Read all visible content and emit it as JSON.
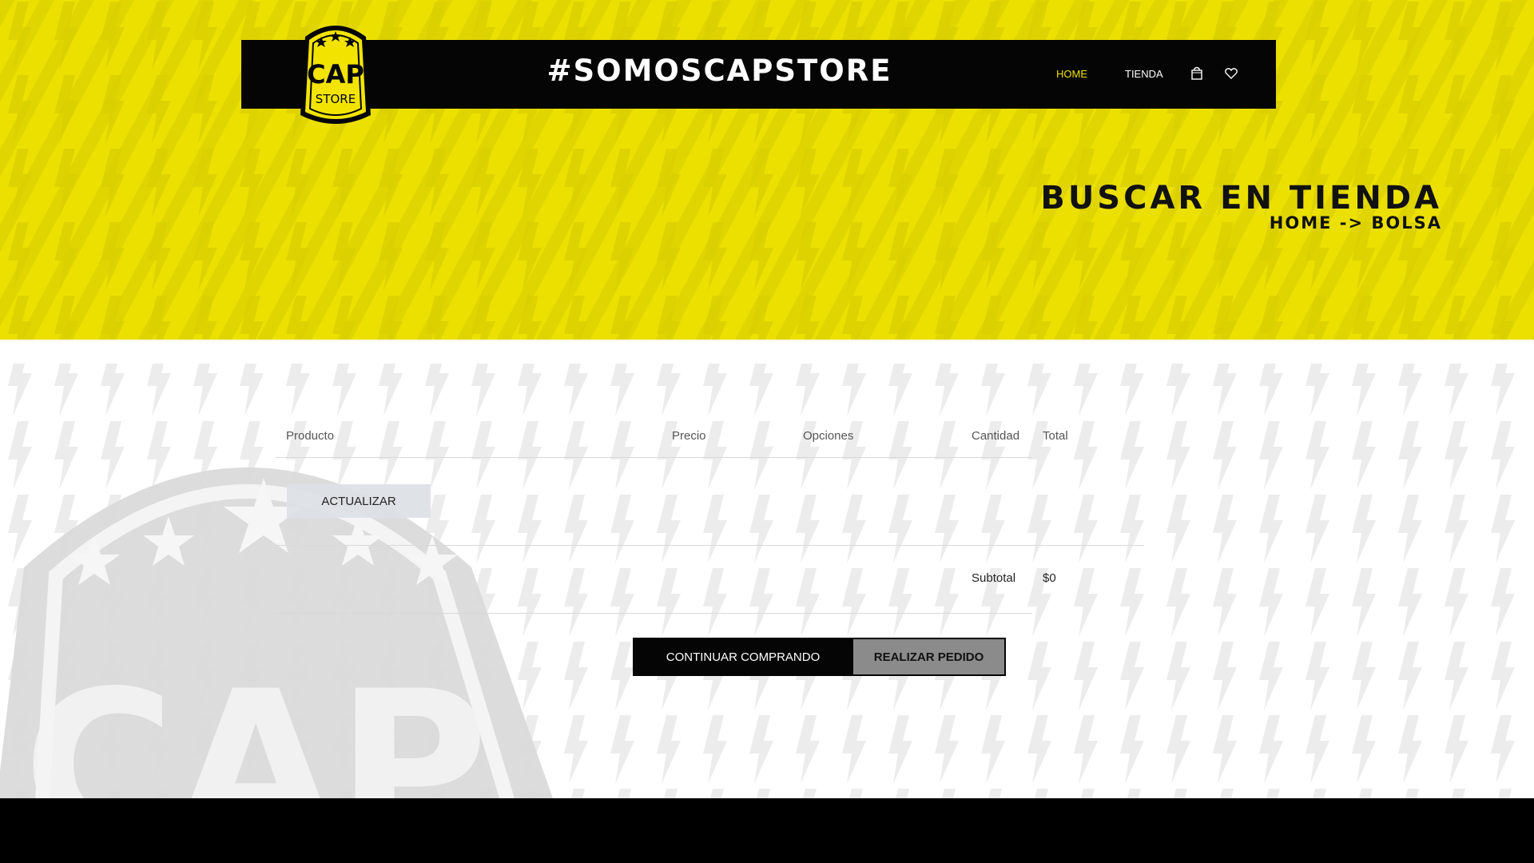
{
  "header": {
    "logo_text_top": "CAP",
    "logo_text_bottom": "STORE",
    "slogan": "#SOMOSCAPSTORE",
    "nav": {
      "home": "HOME",
      "shop": "TIENDA"
    },
    "icons": {
      "bag": "shopping-bag-icon",
      "heart": "heart-icon"
    }
  },
  "hero": {
    "title": "BUSCAR EN TIENDA",
    "breadcrumb": {
      "home": "HOME",
      "arrow": "->",
      "current": "BOLSA"
    }
  },
  "cart": {
    "columns": [
      "Producto",
      "Precio",
      "Opciones",
      "Cantidad",
      "Total"
    ],
    "update_label": "ACTUALIZAR",
    "subtotal_label": "Subtotal",
    "subtotal_value": "$0",
    "continue_label": "CONTINUAR COMPRANDO",
    "order_label": "REALIZAR PEDIDO"
  },
  "colors": {
    "brand_yellow": "#ECE000",
    "black": "#050505",
    "nav_active": "#F0E000",
    "order_button": "#8B8B8B"
  }
}
